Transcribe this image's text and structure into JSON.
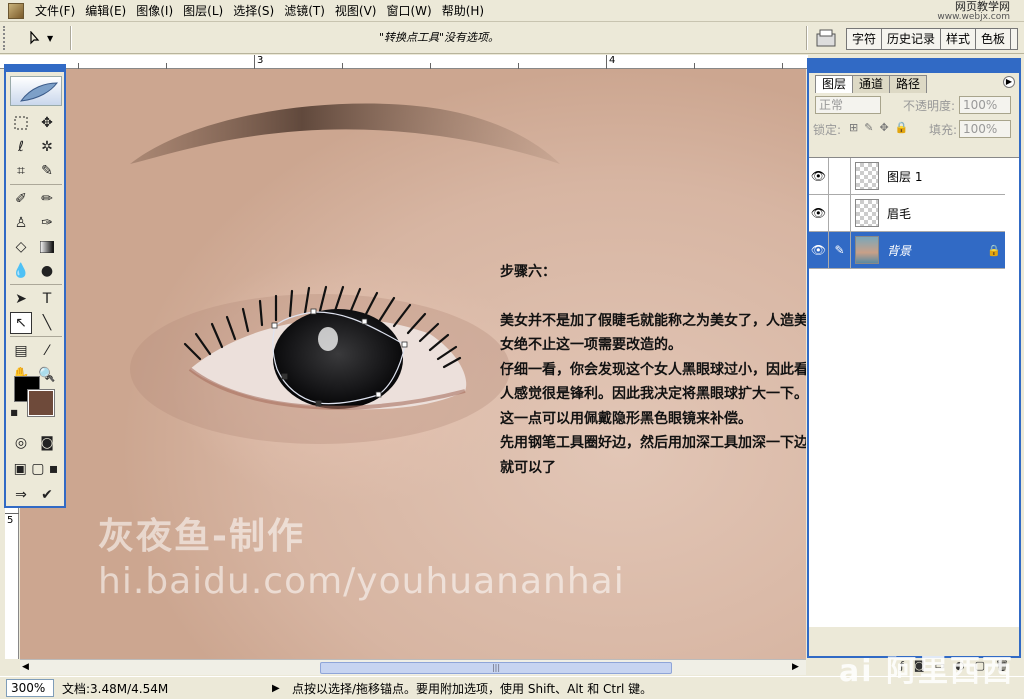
{
  "menubar": {
    "items": [
      "文件(F)",
      "编辑(E)",
      "图像(I)",
      "图层(L)",
      "选择(S)",
      "滤镜(T)",
      "视图(V)",
      "窗口(W)",
      "帮助(H)"
    ]
  },
  "watermark_top": {
    "title": "网页教学网",
    "url": "www.webjx.com"
  },
  "options_bar": {
    "hint": "\"转换点工具\"没有选项。",
    "palette_well_tabs": [
      "字符",
      "历史记录",
      "样式",
      "色板"
    ]
  },
  "rulers": {
    "top_labels": [
      "3",
      "4"
    ],
    "left_labels": [
      "5"
    ]
  },
  "canvas": {
    "note_title": "步骤六：",
    "note_body": "美女并不是加了假睫毛就能称之为美女了，人造美女绝不止这一项需要改造的。\n仔细一看，你会发现这个女人黑眼球过小，因此看人感觉很是锋利。因此我决定将黑眼球扩大一下。这一点可以用佩戴隐形黑色眼镜来补偿。\n先用钢笔工具圈好边，然后用加深工具加深一下边就可以了",
    "credit_name": "灰夜鱼-制作",
    "credit_url": "hi.baidu.com/youhuananhai"
  },
  "toolbox": {
    "foreground_color": "#000000",
    "background_color": "#6e4a3a"
  },
  "layers_panel": {
    "tabs": [
      "图层",
      "通道",
      "路径"
    ],
    "blend_mode": "正常",
    "opacity_label": "不透明度:",
    "opacity_value": "100%",
    "lock_label": "锁定:",
    "fill_label": "填充:",
    "fill_value": "100%",
    "layers": [
      {
        "name": "图层 1",
        "visible": true,
        "active": false
      },
      {
        "name": "眉毛",
        "visible": true,
        "active": false
      },
      {
        "name": "背景",
        "visible": true,
        "active": true,
        "locked": true
      }
    ]
  },
  "statusbar": {
    "zoom": "300%",
    "doc_info": "文档:3.48M/4.54M",
    "message": "点按以选择/拖移锚点。要用附加选项，使用 Shift、Alt 和 Ctrl 键。"
  },
  "brand_bottom": "ai 阿里西西"
}
